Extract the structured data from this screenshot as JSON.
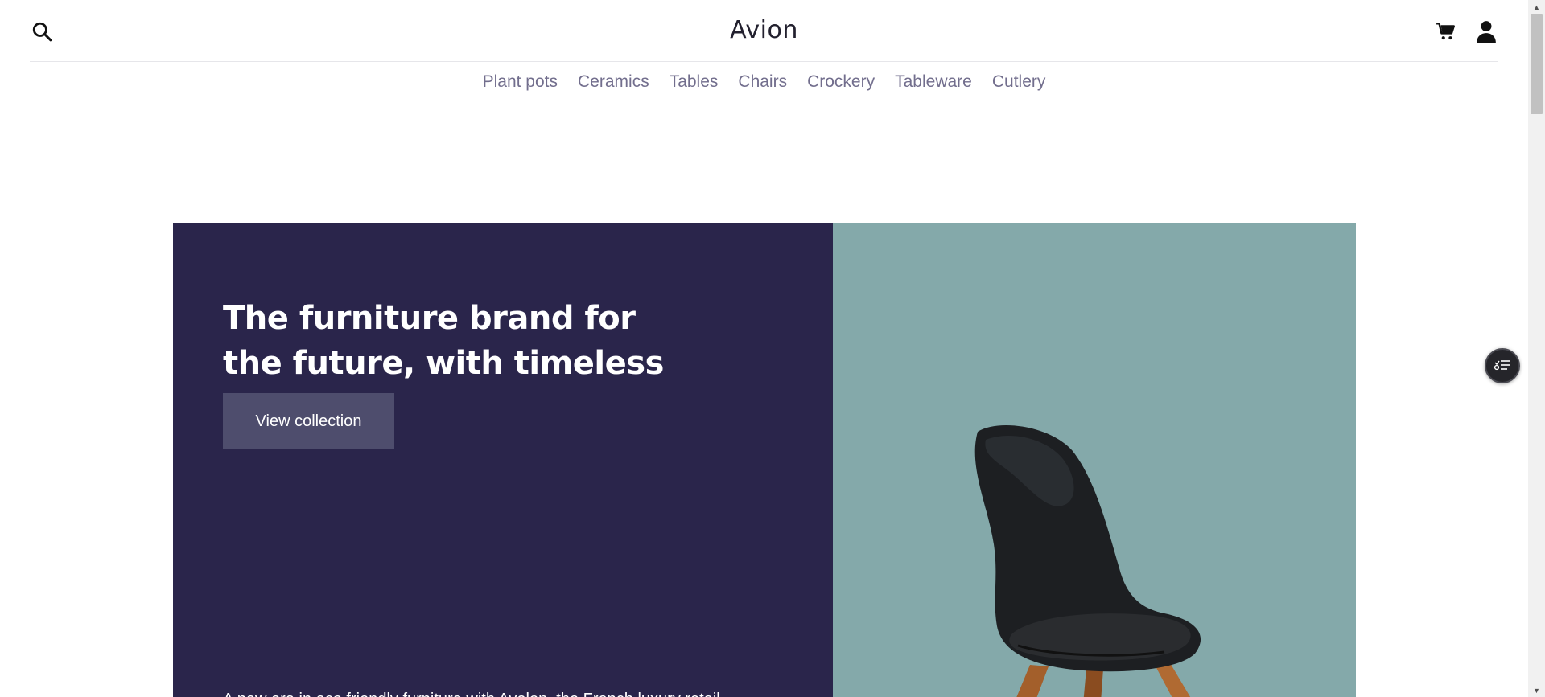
{
  "header": {
    "brand": "Avion",
    "icons": [
      "search-icon",
      "cart-icon",
      "user-icon"
    ]
  },
  "nav": {
    "categories": [
      "Plant pots",
      "Ceramics",
      "Tables",
      "Chairs",
      "Crockery",
      "Tableware",
      "Cutlery"
    ]
  },
  "hero": {
    "title": "The furniture brand for the future, with timeless designs",
    "button_label": "View collection",
    "description": "A new era in eco friendly furniture with Avelon, the French luxury retail",
    "colors": {
      "left_bg": "#2a254b",
      "right_bg": "#84a9aa",
      "button_bg": "#4e4d6d"
    },
    "image": "chair"
  },
  "floating_button": {
    "icon": "filter-list-icon"
  },
  "scrollbar": {
    "up": "▲",
    "down": "▼"
  }
}
